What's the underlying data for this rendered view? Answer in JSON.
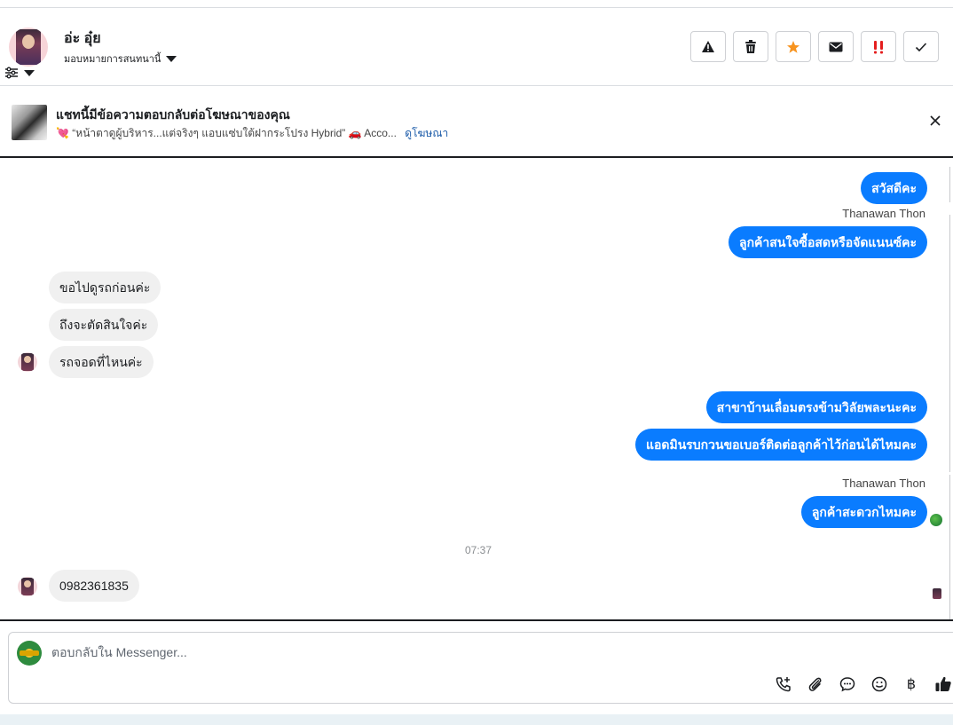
{
  "header": {
    "contact_name": "อ่ะ อุ๋ย",
    "assign_label": "มอบหมายการสนทนานี้",
    "actions": [
      {
        "name": "spam-icon",
        "color": "#1c1e21"
      },
      {
        "name": "trash-icon",
        "color": "#1c1e21"
      },
      {
        "name": "star-icon",
        "color": "#f7931e"
      },
      {
        "name": "envelope-icon",
        "color": "#1c1e21"
      },
      {
        "name": "important-icon",
        "color": "#e41e1e"
      },
      {
        "name": "check-icon",
        "color": "#1c1e21"
      }
    ]
  },
  "ad_banner": {
    "title": "แชทนี้มีข้อความตอบกลับต่อโฆษณาของคุณ",
    "heart": "💘",
    "description": "“หน้าตาดูผู้บริหาร...แต่จริงๆ แอบแซ่บใต้ฝากระโปรง Hybrid” 🚗 Acco...",
    "link": "ดูโฆษณา"
  },
  "messages": {
    "m1": "สวัสดีคะ",
    "sender1": "Thanawan Thon",
    "m2": "ลูกค้าสนใจซื้อสดหรือจัดแนนซ์คะ",
    "m3": "ขอไปดูรถก่อนค่ะ",
    "m4": "ถึงจะตัดสินใจค่ะ",
    "m5": "รถจอดที่ไหนค่ะ",
    "m6": "สาขาบ้านเลื่อมตรงข้ามวิลัยพละนะคะ",
    "m7": "แอดมินรบกวนขอเบอร์ติดต่อลูกค้าไว้ก่อนได้ไหมคะ",
    "sender2": "Thanawan Thon",
    "m8": "ลูกค้าสะดวกไหมคะ",
    "time": "07:37",
    "m9": "0982361835"
  },
  "composer": {
    "placeholder": "ตอบกลับใน Messenger...",
    "tools": [
      "call-add-icon",
      "paperclip-icon",
      "chat-bubble-icon",
      "emoji-icon",
      "baht-icon",
      "thumbs-up-icon"
    ],
    "baht_symbol": "฿"
  },
  "colors": {
    "outgoing": "#0a7cff",
    "incoming": "#f0f0f0"
  }
}
